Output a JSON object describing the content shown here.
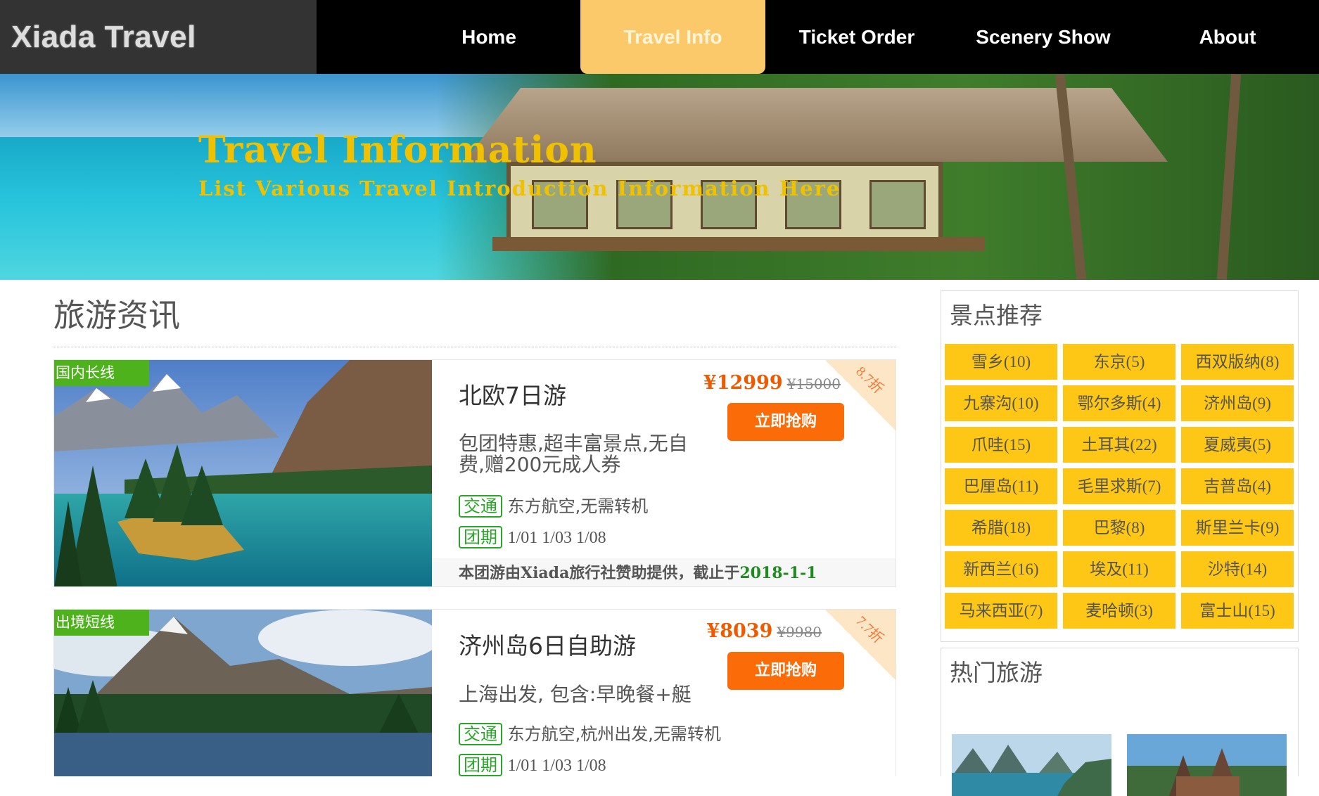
{
  "brand": "Xiada Travel Agency",
  "nav": [
    {
      "label": "Home",
      "active": false
    },
    {
      "label": "Travel Info",
      "active": true
    },
    {
      "label": "Ticket Order",
      "active": false
    },
    {
      "label": "Scenery Show",
      "active": false
    },
    {
      "label": "About",
      "active": false
    }
  ],
  "banner": {
    "title": "Travel Information",
    "subtitle": "List Various Travel Introduction Information Here"
  },
  "section_title": "旅游资讯",
  "cards": [
    {
      "category": "国内长线",
      "title": "北欧7日游",
      "desc": "包团特惠,超丰富景点,无自费,赠200元成人券",
      "price": "¥12999",
      "old_price": "¥15000",
      "buy": "立即抢购",
      "discount": "8.7折",
      "transport_tag": "交通",
      "transport": "东方航空,无需转机",
      "dates_tag": "团期",
      "dates": "1/01 1/03 1/08",
      "footer_prefix": "本团游由Xiada旅行社赞助提供，截止于",
      "footer_date": "2018-1-1"
    },
    {
      "category": "出境短线",
      "title": "济州岛6日自助游",
      "desc": "上海出发, 包含:早晚餐+艇",
      "price": "¥8039",
      "old_price": "¥9980",
      "buy": "立即抢购",
      "discount": "7.7折",
      "transport_tag": "交通",
      "transport": "东方航空,杭州出发,无需转机",
      "dates_tag": "团期",
      "dates": "1/01 1/03 1/08"
    }
  ],
  "spots_title": "景点推荐",
  "spots": [
    "雪乡(10)",
    "东京(5)",
    "西双版纳(8)",
    "九寨沟(10)",
    "鄂尔多斯(4)",
    "济州岛(9)",
    "爪哇(15)",
    "土耳其(22)",
    "夏威夷(5)",
    "巴厘岛(11)",
    "毛里求斯(7)",
    "吉普岛(4)",
    "希腊(18)",
    "巴黎(8)",
    "斯里兰卡(9)",
    "新西兰(16)",
    "埃及(11)",
    "沙特(14)",
    "马来西亚(7)",
    "麦哈顿(3)",
    "富士山(15)"
  ],
  "hot_title": "热门旅游"
}
